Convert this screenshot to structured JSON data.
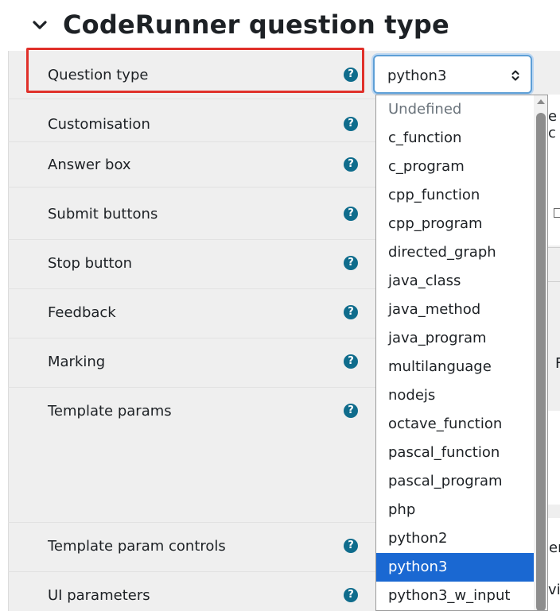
{
  "section": {
    "title": "CodeRunner question type",
    "collapse_icon": "chevron-down-icon"
  },
  "rows": [
    {
      "label": "Question type",
      "help_icon": "question-circle-icon"
    },
    {
      "label": "Customisation",
      "help_icon": "question-circle-icon"
    },
    {
      "label": "Answer box",
      "help_icon": "question-circle-icon"
    },
    {
      "label": "Submit buttons",
      "help_icon": "question-circle-icon"
    },
    {
      "label": "Stop button",
      "help_icon": "question-circle-icon"
    },
    {
      "label": "Feedback",
      "help_icon": "question-circle-icon"
    },
    {
      "label": "Marking",
      "help_icon": "question-circle-icon"
    },
    {
      "label": "Template params",
      "help_icon": "question-circle-icon"
    },
    {
      "label": "Template param controls",
      "help_icon": "question-circle-icon"
    },
    {
      "label": "UI parameters",
      "help_icon": "question-circle-icon"
    }
  ],
  "help_glyph": "?",
  "question_type_select": {
    "value": "python3",
    "options": [
      {
        "label": "Undefined",
        "disabled": true
      },
      {
        "label": "c_function"
      },
      {
        "label": "c_program"
      },
      {
        "label": "cpp_function"
      },
      {
        "label": "cpp_program"
      },
      {
        "label": "directed_graph"
      },
      {
        "label": "java_class"
      },
      {
        "label": "java_method"
      },
      {
        "label": "java_program"
      },
      {
        "label": "multilanguage"
      },
      {
        "label": "nodejs"
      },
      {
        "label": "octave_function"
      },
      {
        "label": "pascal_function"
      },
      {
        "label": "pascal_program"
      },
      {
        "label": "php"
      },
      {
        "label": "python2"
      },
      {
        "label": "python3",
        "selected": true
      },
      {
        "label": "python3_w_input"
      }
    ]
  },
  "peeks": {
    "e_c": "e c",
    "f": "F",
    "en": "er",
    "vi": "vi"
  },
  "colors": {
    "highlight": "#e0302a",
    "help_icon": "#0f6c8c",
    "selected_option": "#1a68d2",
    "focus_border": "#5e9fd6"
  }
}
